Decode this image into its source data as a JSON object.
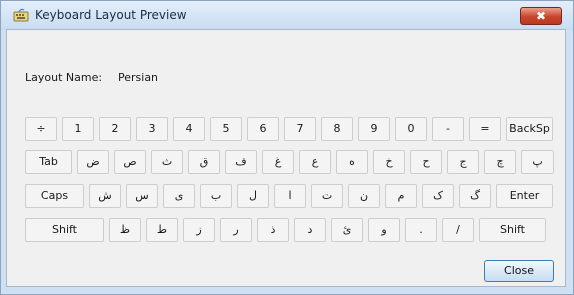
{
  "window": {
    "title": "Keyboard Layout Preview",
    "close_glyph": "✖"
  },
  "layout": {
    "name_label": "Layout Name:",
    "name_value": "Persian"
  },
  "keyboard": {
    "rows": [
      [
        "÷",
        "1",
        "2",
        "3",
        "4",
        "5",
        "6",
        "7",
        "8",
        "9",
        "0",
        "-",
        "=",
        "BackSp"
      ],
      [
        "Tab",
        "ض",
        "ص",
        "ث",
        "ق",
        "ف",
        "غ",
        "ع",
        "ه",
        "خ",
        "ح",
        "ج",
        "چ",
        "پ"
      ],
      [
        "Caps",
        "ش",
        "س",
        "ی",
        "ب",
        "ل",
        "ا",
        "ت",
        "ن",
        "م",
        "ک",
        "گ",
        "Enter"
      ],
      [
        "Shift",
        "ظ",
        "ط",
        "ز",
        "ر",
        "ذ",
        "د",
        "ئ",
        "و",
        ".",
        "/",
        "Shift"
      ]
    ]
  },
  "buttons": {
    "close_label": "Close"
  },
  "colors": {
    "title_bar": "#c8dcf2",
    "close_button": "#c8452c",
    "dialog_background": "#f0f0f0",
    "default_button_border": "#3c7fb1"
  }
}
